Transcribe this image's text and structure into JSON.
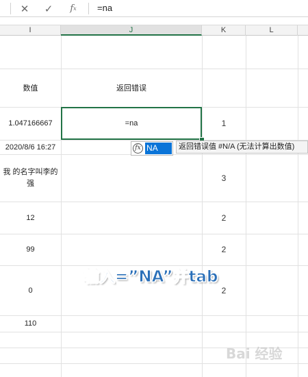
{
  "formula_bar": {
    "cancel_icon": "close-icon",
    "enter_icon": "check-icon",
    "fx_label": "fx",
    "value": "=na"
  },
  "columns": [
    "I",
    "J",
    "K",
    "L"
  ],
  "cells": {
    "i_header": "数值",
    "j_header": "返回错误",
    "i_r1": "1.047166667",
    "j_active": "=na",
    "k_r1": "1",
    "i_r2": "2020/8/6 16:27",
    "i_r3": "我    的名字叫李的强",
    "k_r3": "3",
    "i_r4": "12",
    "k_r4": "2",
    "i_r5": "99",
    "k_r5": "2",
    "i_r6": "0",
    "k_r6": "2",
    "i_r7": "110"
  },
  "autocomplete": {
    "item": "NA",
    "tooltip": "返回错误值 #N/A (无法计算出数值)"
  },
  "caption": "输入=”NA”并tab",
  "watermark": "Bai 经验",
  "colors": {
    "accent": "#217346",
    "selection": "#0a74d8",
    "caption": "#2a6fb8"
  }
}
